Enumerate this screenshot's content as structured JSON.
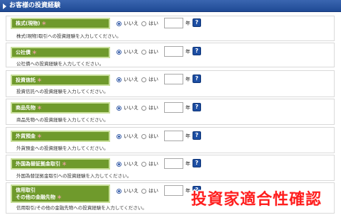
{
  "section_title": "お客様の投資経験",
  "radio_no_label": "いいえ",
  "radio_yes_label": "はい",
  "year_unit": "年",
  "help_label": "?",
  "required_mark": "＊",
  "items": [
    {
      "label": "株式(現物)",
      "hint": "株式(現物)取引への投資経験を入力してください。",
      "selected": "いいえ",
      "years": ""
    },
    {
      "label": "公社債",
      "hint": "公社債への投資経験を入力してください。",
      "selected": "いいえ",
      "years": ""
    },
    {
      "label": "投資信託",
      "hint": "投資信託への投資経験を入力してください。",
      "selected": "いいえ",
      "years": ""
    },
    {
      "label": "商品先物",
      "hint": "商品先物への投資経験を入力してください。",
      "selected": "いいえ",
      "years": ""
    },
    {
      "label": "外貨預金",
      "hint": "外貨預金への投資経験を入力してください。",
      "selected": "いいえ",
      "years": ""
    },
    {
      "label": "外国為替証拠金取引",
      "hint": "外国為替証拠金取引への投資経験を入力してください。",
      "selected": "いいえ",
      "years": ""
    },
    {
      "label": "信用取引",
      "label_line2": "その他の金融先物",
      "hint": "信用取引/その他の金融先物への投資経験を入力してください。",
      "selected": "いいえ",
      "years": ""
    }
  ],
  "overlay_caption": "投資家適合性確認",
  "colors": {
    "header_blue": "#2a58a6",
    "label_green": "#6f9a2c",
    "help_blue": "#1d4ea3",
    "overlay_red": "#ff1e1e"
  }
}
